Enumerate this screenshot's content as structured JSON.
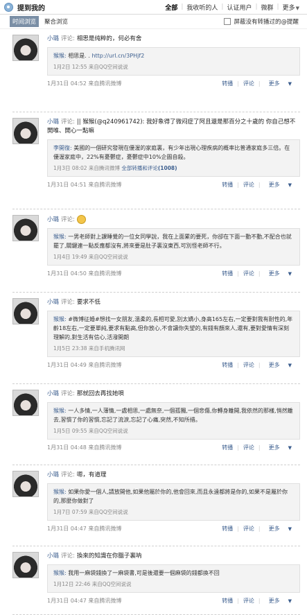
{
  "header": {
    "title": "提到我的",
    "filters": [
      "全部",
      "我收听的人",
      "认证用户",
      "微群",
      "更多"
    ]
  },
  "subbar": {
    "tabs": [
      "时间浏览",
      "聚合浏览"
    ],
    "checkbox_label": "屏蔽没有转播过的@提醒"
  },
  "actions": {
    "repost": "转播",
    "comment": "评论",
    "more": "更多"
  },
  "items": [
    {
      "name": "小璐",
      "verb": "评论:",
      "text": "相思是纯粹的，何必有舍",
      "quote_name": "猴猴:",
      "quote_text": "相思是. .",
      "quote_link": "http://url.cn/3PHjf2",
      "quote_meta": "1月2日 12:55 来自QQ空间说说",
      "time": "1月31日 04:52 来自腾讯微博"
    },
    {
      "name": "小璐",
      "verb": "评论:",
      "text": "|| 猴猴(@q240961742): 我好象得了微闷症了阿且還是那百分之十歲的 你自己想不開唯、開心一點嘛",
      "quote_name": "李開復:",
      "quote_text": "美國的一個研究發現在優渥的家庭裏，有少年出現心理疾病的概率比普通家庭多三倍。在優渥家庭中，22%有憂鬱症，憂鬱症中10%企圖自殺。",
      "quote_meta": "1月3日 08:02 来自腾讯微博",
      "quote_extra": "全部转播和评论",
      "quote_count": "(1008)",
      "time": "1月31日 04:51 来自腾讯微博"
    },
    {
      "name": "小璐",
      "verb": "评论:",
      "text": "",
      "quote_name": "猴猴:",
      "quote_text": "一男老師對上課睡覺的一位女同學說，我在上面累的要死，你卻在下面一動不動,不配合也就罷了,關鍵連一點反應都沒有,將來要是肚子裏沒東西,可別怪老師不行。",
      "quote_meta": "1月4日 19:49 来自QQ空间说说",
      "time": "1月31日 04:50 来自腾讯微博"
    },
    {
      "name": "小璐",
      "verb": "评论:",
      "text": "要求不低",
      "quote_name": "猴猴:",
      "quote_text": "#微博征婚#想找一女朋友,溫柔的,長相可愛,別太嬌小,身高165左右,一定要對我有耐性的,年齡18左右,一定要單純,要求有點高,但你放心,不會讓你失望的,有錢有顏來人,還有,要對愛情有深刻理解的,對生活有信心,活潑開朗",
      "quote_meta": "1月5日 23:38 来自手机腾讯网",
      "time": "1月31日 04:49 来自腾讯微博"
    },
    {
      "name": "小璐",
      "verb": "评论:",
      "text": "那就回去再找她唄",
      "quote_name": "猴猴:",
      "quote_text": "一人多情,一人薄情,一處相思,一處無奈,一個孤獨,一個悲傷,你轉身離開,我依然的那樣,悄然離去,習慣了你的習慣,忘記了流淚,忘記了心痛,突然,不知所措。",
      "quote_meta": "1月5日 09:55 来自QQ空间说说",
      "time": "1月31日 04:48 来自腾讯微博"
    },
    {
      "name": "小璐",
      "verb": "评论:",
      "text": "嗯，有道理",
      "quote_name": "猴猴:",
      "quote_text": "如果你愛一個人,請放開他,如果他屬於你的,他會回來,而且永遠都將是你的,如果不是屬於你的,那麼你做對了",
      "quote_meta": "1月7日 07:59 来自QQ空间说说",
      "time": "1月31日 04:47 来自腾讯微博"
    },
    {
      "name": "小璐",
      "verb": "评论:",
      "text": "換來的知識在你腦子裏呐",
      "quote_name": "猴猴:",
      "quote_text": "我用一麻袋錢換了一麻袋書,可是後還要一個麻袋的錢都換不回",
      "quote_meta": "1月12日 22:46 来自QQ空间说说",
      "time": "1月31日 04:47 来自腾讯微博"
    }
  ]
}
